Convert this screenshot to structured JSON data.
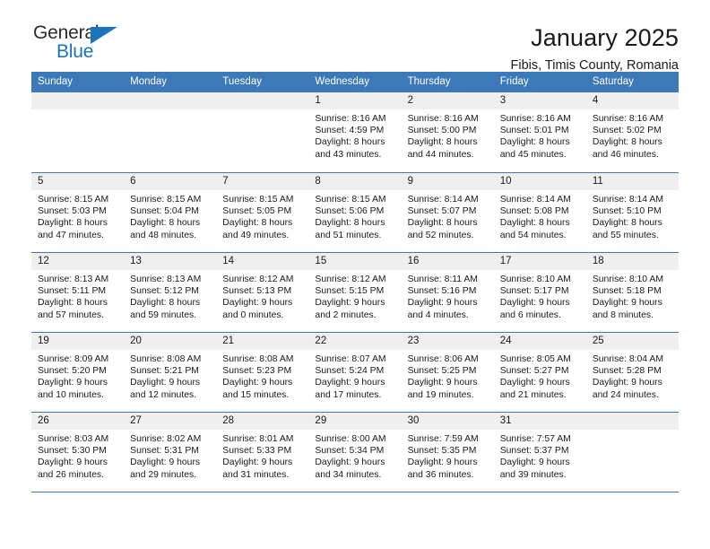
{
  "brand": {
    "name_top": "General",
    "name_bottom": "Blue",
    "triangle_color": "#1b75bb"
  },
  "header": {
    "title": "January 2025",
    "subtitle": "Fibis, Timis County, Romania"
  },
  "theme": {
    "header_blue": "#3b79b8",
    "day_band_gray": "#efefef",
    "text": "#1a1a1a",
    "brand_blue": "#1b75bb"
  },
  "weekdays": [
    "Sunday",
    "Monday",
    "Tuesday",
    "Wednesday",
    "Thursday",
    "Friday",
    "Saturday"
  ],
  "weeks": [
    [
      {
        "day": "",
        "empty": true
      },
      {
        "day": "",
        "empty": true
      },
      {
        "day": "",
        "empty": true
      },
      {
        "day": "1",
        "sunrise": "Sunrise: 8:16 AM",
        "sunset": "Sunset: 4:59 PM",
        "daylight1": "Daylight: 8 hours",
        "daylight2": "and 43 minutes."
      },
      {
        "day": "2",
        "sunrise": "Sunrise: 8:16 AM",
        "sunset": "Sunset: 5:00 PM",
        "daylight1": "Daylight: 8 hours",
        "daylight2": "and 44 minutes."
      },
      {
        "day": "3",
        "sunrise": "Sunrise: 8:16 AM",
        "sunset": "Sunset: 5:01 PM",
        "daylight1": "Daylight: 8 hours",
        "daylight2": "and 45 minutes."
      },
      {
        "day": "4",
        "sunrise": "Sunrise: 8:16 AM",
        "sunset": "Sunset: 5:02 PM",
        "daylight1": "Daylight: 8 hours",
        "daylight2": "and 46 minutes."
      }
    ],
    [
      {
        "day": "5",
        "sunrise": "Sunrise: 8:15 AM",
        "sunset": "Sunset: 5:03 PM",
        "daylight1": "Daylight: 8 hours",
        "daylight2": "and 47 minutes."
      },
      {
        "day": "6",
        "sunrise": "Sunrise: 8:15 AM",
        "sunset": "Sunset: 5:04 PM",
        "daylight1": "Daylight: 8 hours",
        "daylight2": "and 48 minutes."
      },
      {
        "day": "7",
        "sunrise": "Sunrise: 8:15 AM",
        "sunset": "Sunset: 5:05 PM",
        "daylight1": "Daylight: 8 hours",
        "daylight2": "and 49 minutes."
      },
      {
        "day": "8",
        "sunrise": "Sunrise: 8:15 AM",
        "sunset": "Sunset: 5:06 PM",
        "daylight1": "Daylight: 8 hours",
        "daylight2": "and 51 minutes."
      },
      {
        "day": "9",
        "sunrise": "Sunrise: 8:14 AM",
        "sunset": "Sunset: 5:07 PM",
        "daylight1": "Daylight: 8 hours",
        "daylight2": "and 52 minutes."
      },
      {
        "day": "10",
        "sunrise": "Sunrise: 8:14 AM",
        "sunset": "Sunset: 5:08 PM",
        "daylight1": "Daylight: 8 hours",
        "daylight2": "and 54 minutes."
      },
      {
        "day": "11",
        "sunrise": "Sunrise: 8:14 AM",
        "sunset": "Sunset: 5:10 PM",
        "daylight1": "Daylight: 8 hours",
        "daylight2": "and 55 minutes."
      }
    ],
    [
      {
        "day": "12",
        "sunrise": "Sunrise: 8:13 AM",
        "sunset": "Sunset: 5:11 PM",
        "daylight1": "Daylight: 8 hours",
        "daylight2": "and 57 minutes."
      },
      {
        "day": "13",
        "sunrise": "Sunrise: 8:13 AM",
        "sunset": "Sunset: 5:12 PM",
        "daylight1": "Daylight: 8 hours",
        "daylight2": "and 59 minutes."
      },
      {
        "day": "14",
        "sunrise": "Sunrise: 8:12 AM",
        "sunset": "Sunset: 5:13 PM",
        "daylight1": "Daylight: 9 hours",
        "daylight2": "and 0 minutes."
      },
      {
        "day": "15",
        "sunrise": "Sunrise: 8:12 AM",
        "sunset": "Sunset: 5:15 PM",
        "daylight1": "Daylight: 9 hours",
        "daylight2": "and 2 minutes."
      },
      {
        "day": "16",
        "sunrise": "Sunrise: 8:11 AM",
        "sunset": "Sunset: 5:16 PM",
        "daylight1": "Daylight: 9 hours",
        "daylight2": "and 4 minutes."
      },
      {
        "day": "17",
        "sunrise": "Sunrise: 8:10 AM",
        "sunset": "Sunset: 5:17 PM",
        "daylight1": "Daylight: 9 hours",
        "daylight2": "and 6 minutes."
      },
      {
        "day": "18",
        "sunrise": "Sunrise: 8:10 AM",
        "sunset": "Sunset: 5:18 PM",
        "daylight1": "Daylight: 9 hours",
        "daylight2": "and 8 minutes."
      }
    ],
    [
      {
        "day": "19",
        "sunrise": "Sunrise: 8:09 AM",
        "sunset": "Sunset: 5:20 PM",
        "daylight1": "Daylight: 9 hours",
        "daylight2": "and 10 minutes."
      },
      {
        "day": "20",
        "sunrise": "Sunrise: 8:08 AM",
        "sunset": "Sunset: 5:21 PM",
        "daylight1": "Daylight: 9 hours",
        "daylight2": "and 12 minutes."
      },
      {
        "day": "21",
        "sunrise": "Sunrise: 8:08 AM",
        "sunset": "Sunset: 5:23 PM",
        "daylight1": "Daylight: 9 hours",
        "daylight2": "and 15 minutes."
      },
      {
        "day": "22",
        "sunrise": "Sunrise: 8:07 AM",
        "sunset": "Sunset: 5:24 PM",
        "daylight1": "Daylight: 9 hours",
        "daylight2": "and 17 minutes."
      },
      {
        "day": "23",
        "sunrise": "Sunrise: 8:06 AM",
        "sunset": "Sunset: 5:25 PM",
        "daylight1": "Daylight: 9 hours",
        "daylight2": "and 19 minutes."
      },
      {
        "day": "24",
        "sunrise": "Sunrise: 8:05 AM",
        "sunset": "Sunset: 5:27 PM",
        "daylight1": "Daylight: 9 hours",
        "daylight2": "and 21 minutes."
      },
      {
        "day": "25",
        "sunrise": "Sunrise: 8:04 AM",
        "sunset": "Sunset: 5:28 PM",
        "daylight1": "Daylight: 9 hours",
        "daylight2": "and 24 minutes."
      }
    ],
    [
      {
        "day": "26",
        "sunrise": "Sunrise: 8:03 AM",
        "sunset": "Sunset: 5:30 PM",
        "daylight1": "Daylight: 9 hours",
        "daylight2": "and 26 minutes."
      },
      {
        "day": "27",
        "sunrise": "Sunrise: 8:02 AM",
        "sunset": "Sunset: 5:31 PM",
        "daylight1": "Daylight: 9 hours",
        "daylight2": "and 29 minutes."
      },
      {
        "day": "28",
        "sunrise": "Sunrise: 8:01 AM",
        "sunset": "Sunset: 5:33 PM",
        "daylight1": "Daylight: 9 hours",
        "daylight2": "and 31 minutes."
      },
      {
        "day": "29",
        "sunrise": "Sunrise: 8:00 AM",
        "sunset": "Sunset: 5:34 PM",
        "daylight1": "Daylight: 9 hours",
        "daylight2": "and 34 minutes."
      },
      {
        "day": "30",
        "sunrise": "Sunrise: 7:59 AM",
        "sunset": "Sunset: 5:35 PM",
        "daylight1": "Daylight: 9 hours",
        "daylight2": "and 36 minutes."
      },
      {
        "day": "31",
        "sunrise": "Sunrise: 7:57 AM",
        "sunset": "Sunset: 5:37 PM",
        "daylight1": "Daylight: 9 hours",
        "daylight2": "and 39 minutes."
      },
      {
        "day": "",
        "empty": true
      }
    ]
  ]
}
